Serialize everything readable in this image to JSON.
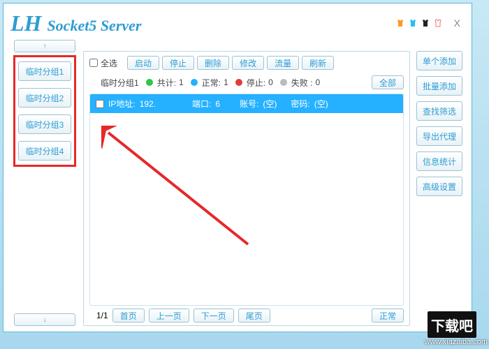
{
  "title": {
    "lh": "LH",
    "sub": "Socket5 Server"
  },
  "close": "X",
  "sidebar": {
    "up": "↑",
    "down": "↓",
    "groups": [
      "临时分组1",
      "临时分组2",
      "临时分组3",
      "临时分组4"
    ]
  },
  "toolbar": {
    "select_all": "全选",
    "buttons": [
      "启动",
      "停止",
      "删除",
      "修改",
      "流量",
      "刷新"
    ]
  },
  "status": {
    "group_name": "临时分组1",
    "total_label": "共计:",
    "total": "1",
    "normal_label": "正常:",
    "normal": "1",
    "stopped_label": "停止:",
    "stopped": "0",
    "failed_label": "失败 :",
    "failed": "0",
    "all_btn": "全部"
  },
  "row": {
    "ip_label": "IP地址:",
    "ip": "192.",
    "port_label": "端口:",
    "port": "6",
    "account_label": "账号:",
    "account": "(空)",
    "pwd_label": "密码:",
    "pwd": "(空)"
  },
  "pager": {
    "page": "1/1",
    "first": "首页",
    "prev": "上一页",
    "next": "下一页",
    "last": "尾页",
    "normal": "正常"
  },
  "rightbar": {
    "buttons": [
      "单个添加",
      "批量添加",
      "查找筛选",
      "导出代理",
      "信息统计",
      "高级设置"
    ]
  },
  "watermark": "www.xiazaiba.com",
  "badge": "下载吧"
}
